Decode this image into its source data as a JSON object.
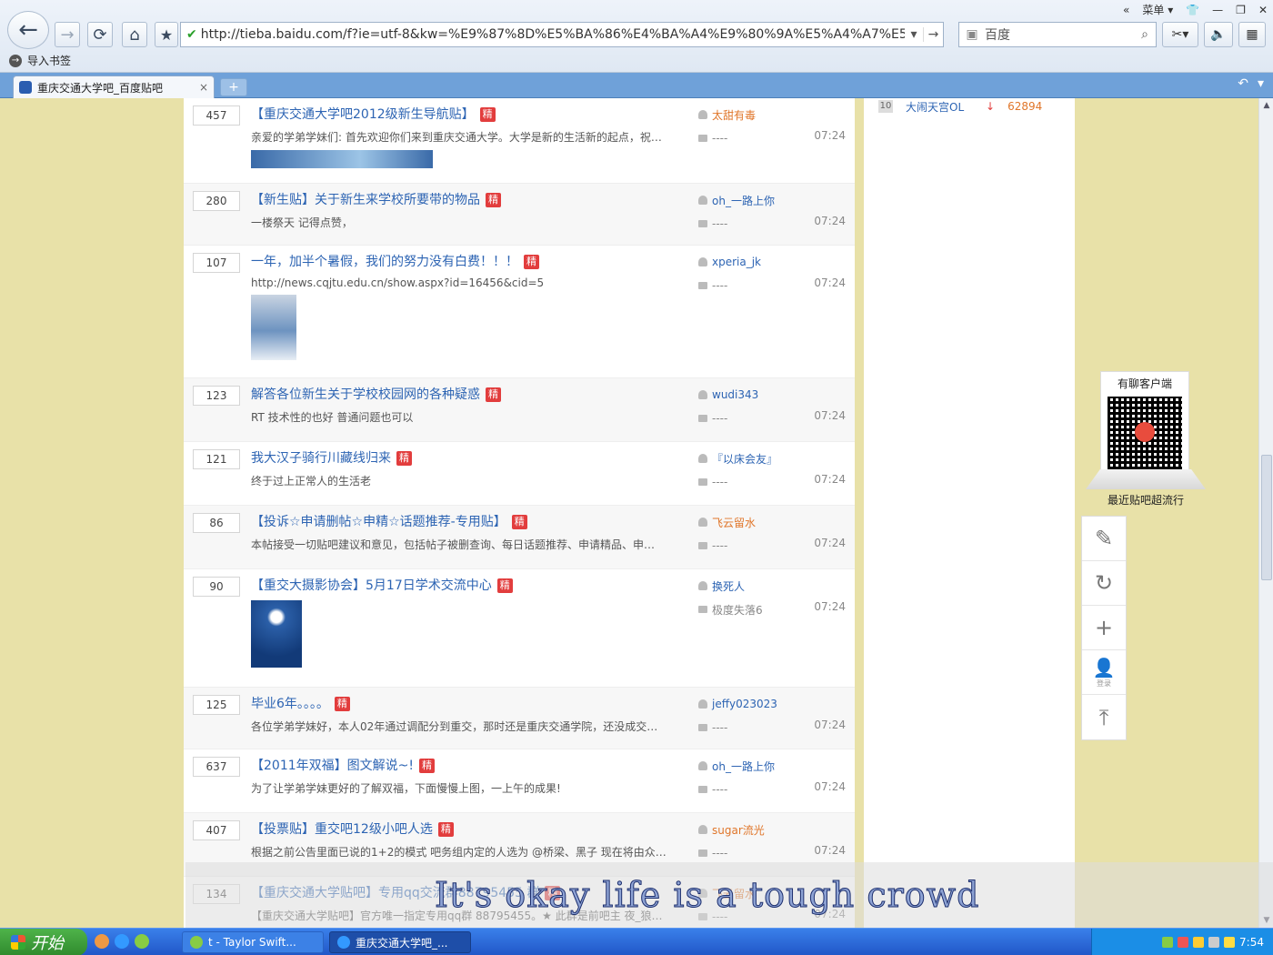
{
  "window": {
    "menu_label": "菜单"
  },
  "toolbar": {
    "url": "http://tieba.baidu.com/f?ie=utf-8&kw=%E9%87%8D%E5%BA%86%E4%BA%A4%E9%80%9A%E5%A4%A7%E5%",
    "search_placeholder": "百度",
    "bookmark_import": "导入书签"
  },
  "tab": {
    "title": "重庆交通大学吧_百度贴吧"
  },
  "posts": [
    {
      "replies": "457",
      "title": "【重庆交通大学吧2012级新生导航贴】",
      "jing": "精",
      "abstract": "亲爱的学弟学妹们: 首先欢迎你们来到重庆交通大学。大学是新的生活新的起点，祝…",
      "author": "太甜有毒",
      "author_orange": true,
      "last": "----",
      "time": "07:24",
      "image": "banner"
    },
    {
      "replies": "280",
      "title": "【新生贴】关于新生来学校所要带的物品",
      "jing": "精",
      "abstract": "一楼祭天 记得点赞，",
      "author": "oh_一路上你",
      "author_orange": false,
      "last": "----",
      "time": "07:24",
      "image": ""
    },
    {
      "replies": "107",
      "title": "一年，加半个暑假，我们的努力没有白费！！！",
      "jing": "精",
      "abstract": "http://news.cqjtu.edu.cn/show.aspx?id=16456&cid=5",
      "author": "xperia_jk",
      "author_orange": false,
      "last": "----",
      "time": "07:24",
      "image": "thumb"
    },
    {
      "replies": "123",
      "title": "解答各位新生关于学校校园网的各种疑惑",
      "jing": "精",
      "abstract": "RT 技术性的也好 普通问题也可以",
      "author": "wudi343",
      "author_orange": false,
      "last": "----",
      "time": "07:24",
      "image": ""
    },
    {
      "replies": "121",
      "title": "我大汉子骑行川藏线归来",
      "jing": "精",
      "abstract": "终于过上正常人的生活老",
      "author": "『以床会友』",
      "author_orange": false,
      "last": "----",
      "time": "07:24",
      "image": ""
    },
    {
      "replies": "86",
      "title": "【投诉☆申请删帖☆申精☆话题推荐-专用贴】",
      "jing": "精",
      "abstract": "本帖接受一切贴吧建议和意见，包括帖子被删查询、每日话题推荐、申请精品、申…",
      "author": "飞云留水",
      "author_orange": true,
      "last": "----",
      "time": "07:24",
      "image": ""
    },
    {
      "replies": "90",
      "title": "【重交大摄影协会】5月17日学术交流中心",
      "jing": "精",
      "abstract": "",
      "author": "换死人",
      "author_orange": false,
      "last": "极度失落6",
      "time": "07:24",
      "image": "poster"
    },
    {
      "replies": "125",
      "title": "毕业6年。。。。",
      "jing": "精",
      "abstract": "各位学弟学妹好，本人02年通过调配分到重交，那时还是重庆交通学院，还没成交…",
      "author": "jeffy023023",
      "author_orange": false,
      "last": "----",
      "time": "07:24",
      "image": ""
    },
    {
      "replies": "637",
      "title": "【2011年双福】图文解说~!",
      "jing": "精",
      "abstract": "为了让学弟学妹更好的了解双福，下面慢慢上图，一上午的成果!",
      "author": "oh_一路上你",
      "author_orange": false,
      "last": "----",
      "time": "07:24",
      "image": ""
    },
    {
      "replies": "407",
      "title": "【投票贴】重交吧12级小吧人选",
      "jing": "精",
      "abstract": "根据之前公告里面已说的1+2的模式 吧务组内定的人选为 @桥梁、黑子 现在将由众…",
      "author": "sugar流光",
      "author_orange": true,
      "last": "----",
      "time": "07:24",
      "image": ""
    },
    {
      "replies": "134",
      "title": "【重庆交通大学贴吧】专用qq交流群88795455 群",
      "jing": "精",
      "abstract": "【重庆交通大学贴吧】官方唯一指定专用qq群 88795455。★ 此群是前吧主 夜_狼…",
      "author": "飞云留水",
      "author_orange": true,
      "last": "----",
      "time": "07:24",
      "image": ""
    }
  ],
  "sidebar": {
    "rank": {
      "num": "10",
      "name": "大闹天宫OL",
      "arrow": "↓",
      "value": "62894"
    },
    "qr_title": "有聊客户端",
    "qr_caption": "最近贴吧超流行",
    "tool_label_user": "登录"
  },
  "overlay": {
    "lyric": "It's okay life is a tough crowd"
  },
  "taskbar": {
    "start": "开始",
    "task1": "t - Taylor Swift...",
    "task2": "重庆交通大学吧_...",
    "clock": "7:54"
  }
}
